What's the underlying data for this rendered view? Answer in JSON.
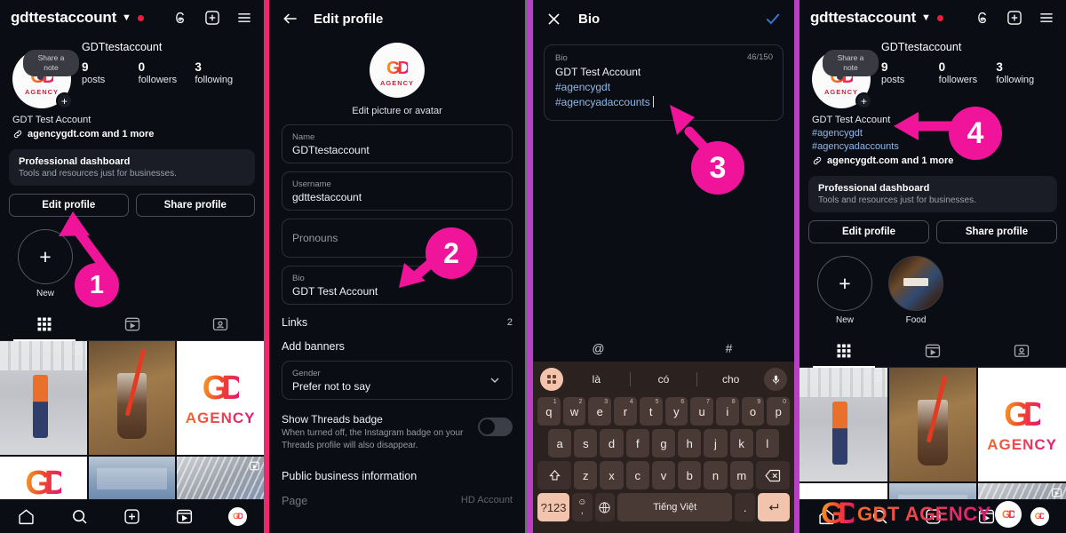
{
  "meta": {
    "accent_pink": "#f0149a",
    "divider_pink": "#ea2a6b",
    "divider_purple": "#b93fc4",
    "bg": "#0b0d14",
    "link_blue": "#8fb8e8"
  },
  "profile": {
    "handle": "gdttestaccount",
    "note_bubble": "Share a note",
    "display_name": "GDTtestaccount",
    "stats": [
      {
        "number": "9",
        "label": "posts"
      },
      {
        "number": "0",
        "label": "followers"
      },
      {
        "number": "3",
        "label": "following"
      }
    ],
    "bio_name": "GDT Test Account",
    "bio_tags": [
      "#agencygdt",
      "#agencyadaccounts"
    ],
    "link_text": "agencygdt.com and 1 more",
    "dashboard_title": "Professional dashboard",
    "dashboard_sub": "Tools and resources just for businesses.",
    "edit_profile": "Edit profile",
    "share_profile": "Share profile",
    "highlights": [
      {
        "label": "New",
        "type": "new"
      },
      {
        "label": "Food",
        "type": "food"
      }
    ],
    "logo_mark": "GD",
    "logo_word": "AGENCY"
  },
  "edit_profile": {
    "title": "Edit profile",
    "edit_picture": "Edit picture or avatar",
    "fields": [
      {
        "label": "Name",
        "value": "GDTtestaccount"
      },
      {
        "label": "Username",
        "value": "gdttestaccount"
      },
      {
        "label": "Pronouns",
        "value": ""
      },
      {
        "label": "Bio",
        "value": "GDT Test Account"
      }
    ],
    "links_label": "Links",
    "links_count": "2",
    "add_banners": "Add banners",
    "gender_label": "Gender",
    "gender_value": "Prefer not to say",
    "threads_badge_title": "Show Threads badge",
    "threads_badge_sub": "When turned off, the Instagram badge on your Threads profile will also disappear.",
    "threads_badge_on": false,
    "public_business_information": "Public business information",
    "cut_row_left": "Page",
    "cut_row_right": "HD Account"
  },
  "bio_editor": {
    "title": "Bio",
    "field_label": "Bio",
    "counter": "46/150",
    "line1": "GDT Test Account",
    "tags": [
      "#agencygdt",
      "#agencyadaccounts"
    ],
    "symbol_row": [
      "@",
      "#"
    ]
  },
  "keyboard": {
    "suggestions": [
      "là",
      "có",
      "cho"
    ],
    "row1": [
      {
        "k": "q",
        "n": "1"
      },
      {
        "k": "w",
        "n": "2"
      },
      {
        "k": "e",
        "n": "3"
      },
      {
        "k": "r",
        "n": "4"
      },
      {
        "k": "t",
        "n": "5"
      },
      {
        "k": "y",
        "n": "6"
      },
      {
        "k": "u",
        "n": "7"
      },
      {
        "k": "i",
        "n": "8"
      },
      {
        "k": "o",
        "n": "9"
      },
      {
        "k": "p",
        "n": "0"
      }
    ],
    "row2": [
      "a",
      "s",
      "d",
      "f",
      "g",
      "h",
      "j",
      "k",
      "l"
    ],
    "row3": [
      "z",
      "x",
      "c",
      "v",
      "b",
      "n",
      "m"
    ],
    "numsym": "?123",
    "emoji": "☺",
    "space_label": "Tiếng Việt",
    "period": ".",
    "comma": ","
  },
  "annotations": [
    {
      "id": "1",
      "number": "1"
    },
    {
      "id": "2",
      "number": "2"
    },
    {
      "id": "3",
      "number": "3"
    },
    {
      "id": "4",
      "number": "4"
    }
  ],
  "watermark": {
    "mark": "GD",
    "text": "GDT AGENCY",
    "word": "AGENCY"
  },
  "icons": {
    "threads": "threads-icon",
    "new_post": "plus-box-icon",
    "menu": "hamburger-icon",
    "home": "home-icon",
    "search": "search-icon",
    "reels": "reels-icon",
    "tagged": "tagged-icon",
    "back": "back-arrow-icon",
    "close": "close-icon",
    "check": "checkmark-icon",
    "chevron": "chevron-down-icon",
    "link": "link-icon",
    "mic": "microphone-icon",
    "shift": "shift-icon",
    "backspace": "backspace-icon",
    "globe": "globe-icon",
    "enter": "enter-icon"
  }
}
